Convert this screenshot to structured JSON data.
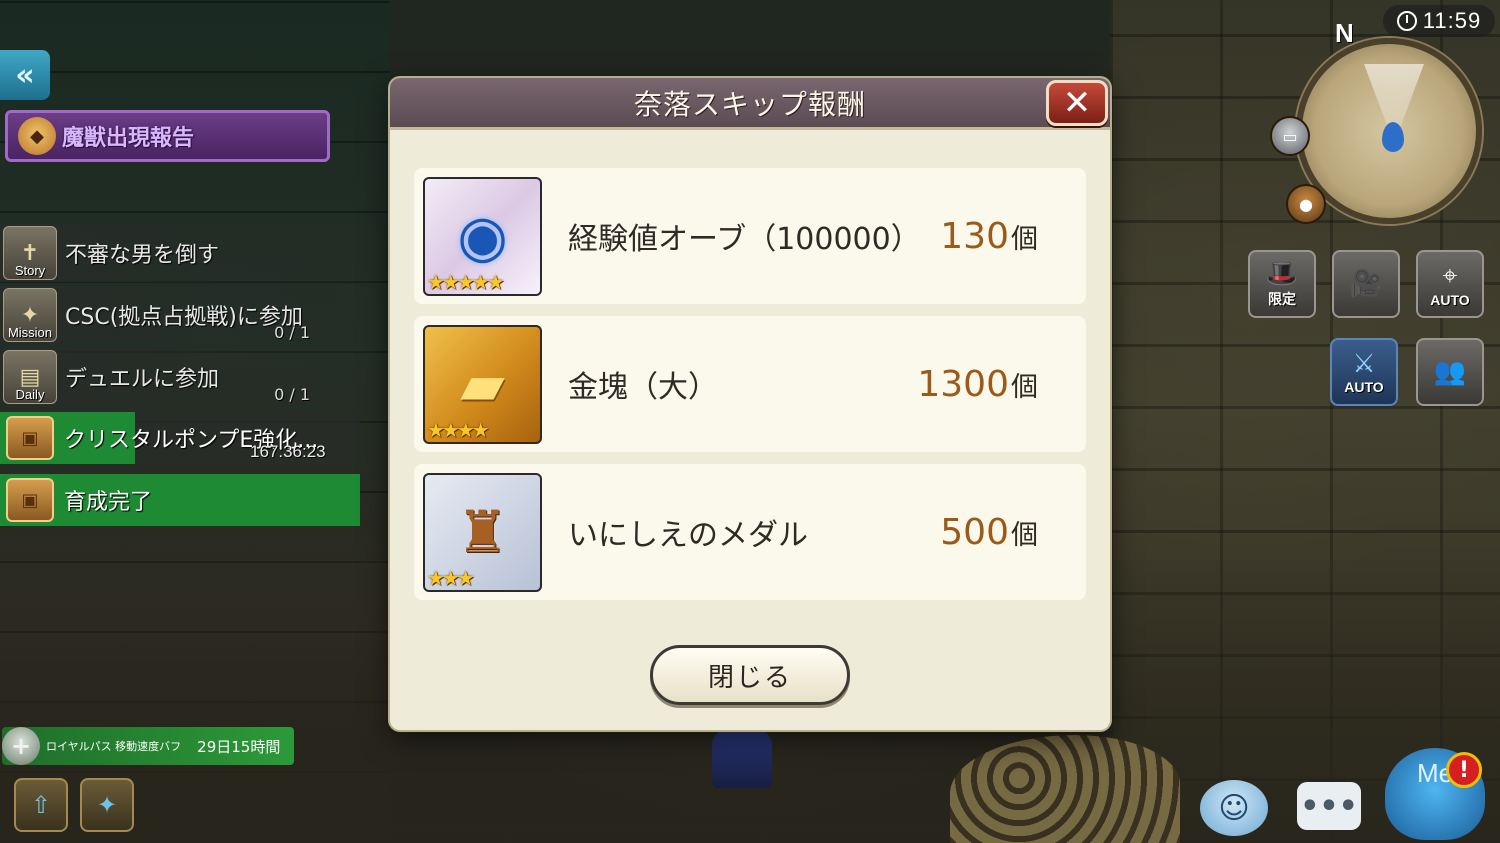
{
  "clock": {
    "time": "11:59"
  },
  "minimap": {
    "north_label": "N"
  },
  "left_hud": {
    "report_banner": "魔獣出現報告",
    "quests": [
      {
        "tag": "Story",
        "text": "不審な男を倒す",
        "progress": ""
      },
      {
        "tag": "Mission",
        "text": "CSC(拠点占拠戦)に参加",
        "progress": "0 / 1"
      },
      {
        "tag": "Daily",
        "text": "デュエルに参加",
        "progress": "0 / 1"
      }
    ],
    "training": [
      {
        "text": "クリスタルポンプE強化...",
        "timer": "167:36:23",
        "progress": 0.35
      },
      {
        "text": "育成完了",
        "progress": 1.0
      }
    ],
    "buff": {
      "name": "ロイヤルパス 移動速度バフ",
      "time": "29日15時間"
    }
  },
  "right_hud": {
    "buttons": [
      {
        "caption": "限定"
      },
      {
        "caption": ""
      },
      {
        "caption": "AUTO"
      },
      {
        "caption": "AUTO"
      },
      {
        "caption": ""
      }
    ],
    "me_label": "Me",
    "alert": "!",
    "chat_glyph": "•••"
  },
  "dialog": {
    "title": "奈落スキップ報酬",
    "close_label": "閉じる",
    "close_x": "✕",
    "rewards": [
      {
        "name": "経験値オーブ（100000）",
        "quantity": "130",
        "unit": "個",
        "stars": 5,
        "icon": "orb-icon"
      },
      {
        "name": "金塊（大）",
        "quantity": "1300",
        "unit": "個",
        "stars": 4,
        "icon": "gold-bar-icon"
      },
      {
        "name": "いにしえのメダル",
        "quantity": "500",
        "unit": "個",
        "stars": 3,
        "icon": "medal-icon"
      }
    ]
  }
}
